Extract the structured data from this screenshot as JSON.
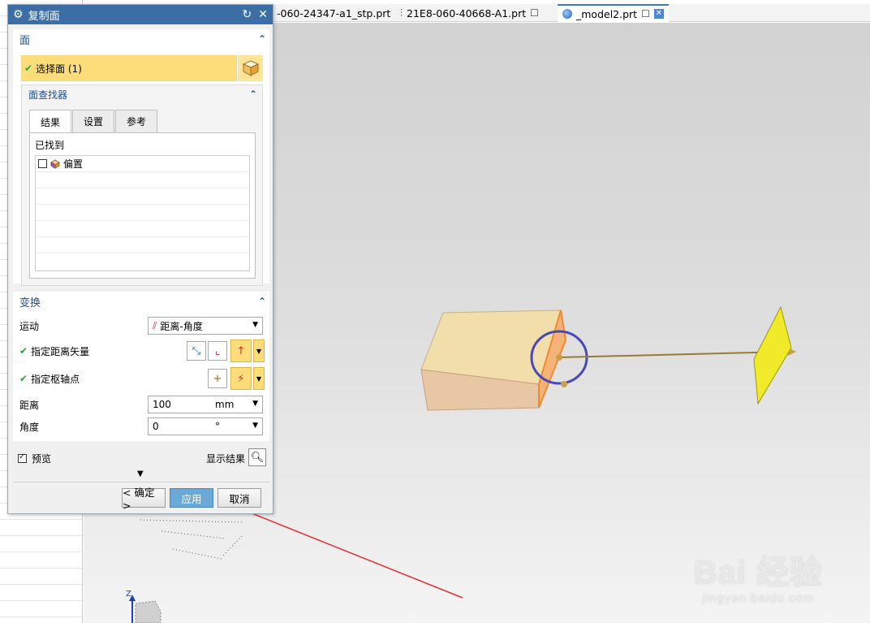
{
  "dialog": {
    "title": "复制面",
    "face_section": {
      "header": "面",
      "select_face_label": "选择面 (1)",
      "finder": {
        "header": "面查找器",
        "tabs": [
          "结果",
          "设置",
          "参考"
        ],
        "found_label": "已找到",
        "items": [
          {
            "label": "偏置",
            "checked": false
          }
        ]
      }
    },
    "transform_section": {
      "header": "变换",
      "motion_label": "运动",
      "motion_value": "距离-角度",
      "distance_vector_label": "指定距离矢量",
      "pivot_label": "指定枢轴点",
      "distance_label": "距离",
      "distance_value": "100",
      "distance_unit": "mm",
      "angle_label": "角度",
      "angle_value": "0",
      "angle_unit": "°"
    },
    "preview_label": "预览",
    "preview_checked": true,
    "show_result_label": "显示结果",
    "buttons": {
      "ok": "< 确定 >",
      "apply": "应用",
      "cancel": "取消"
    }
  },
  "doc_tabs": [
    {
      "label": "-060-24347-a1_stp.prt",
      "active": false
    },
    {
      "label": "21E8-060-40668-A1.prt",
      "active": false
    },
    {
      "label": "_model2.prt",
      "active": true
    }
  ],
  "viewport": {
    "axis_label": "Z",
    "watermark_logo": "Bai 经验",
    "watermark_url": "jingyan.baidu.com"
  },
  "colors": {
    "title_bar": "#3a6ea5",
    "selection_highlight": "#fddc7a",
    "section_header_text": "#1e4f8a",
    "apply_button": "#6aa9d8",
    "check_green": "#27a33a",
    "annotation_arrow": "#e03030"
  }
}
